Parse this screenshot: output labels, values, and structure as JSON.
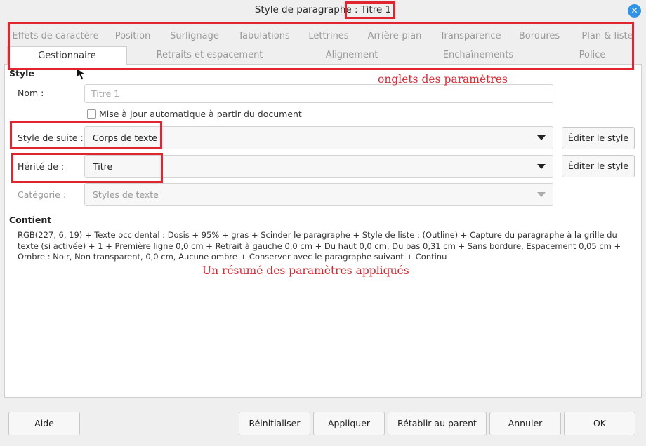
{
  "window": {
    "title": "Style de paragraphe : Titre 1",
    "close_symbol": "✕"
  },
  "tabs_row1": [
    "Effets de caractère",
    "Position",
    "Surlignage",
    "Tabulations",
    "Lettrines",
    "Arrière-plan",
    "Transparence",
    "Bordures",
    "Plan & liste"
  ],
  "tabs_row2": [
    "Gestionnaire",
    "Retraits et espacement",
    "Alignement",
    "Enchaînements",
    "Police"
  ],
  "style_section": {
    "title": "Style",
    "name_label": "Nom :",
    "name_placeholder": "Titre 1",
    "auto_update_label": "Mise à jour automatique à partir du document",
    "next_style_label": "Style de suite :",
    "next_style_value": "Corps de texte",
    "inherit_label": "Hérité de :",
    "inherit_value": "Titre",
    "category_label": "Catégorie :",
    "category_value": "Styles de texte",
    "edit_style_label": "Éditer le style"
  },
  "contains_section": {
    "title": "Contient",
    "text": "RGB(227, 6, 19) + Texte occidental : Dosis + 95% + gras + Scinder le paragraphe + Style de liste : (Outline) + Capture du paragraphe à la grille du texte (si activée) + 1 + Première ligne 0,0 cm + Retrait à gauche 0,0 cm + Du haut 0,0 cm, Du bas 0,31 cm + Sans bordure, Espacement 0,05 cm + Ombre : Noir, Non transparent, 0,0 cm, Aucune ombre + Conserver avec le paragraphe suivant + Continu"
  },
  "footer": {
    "help": "Aide",
    "reset": "Réinitialiser",
    "apply": "Appliquer",
    "restore_parent": "Rétablir au parent",
    "cancel": "Annuler",
    "ok": "OK"
  },
  "annotations": {
    "tabs_note": "onglets des paramètres",
    "summary_note": "Un résumé des paramètres appliqués"
  },
  "colors": {
    "annotation_red": "#e0252f",
    "accent_blue": "#2f93e8"
  }
}
